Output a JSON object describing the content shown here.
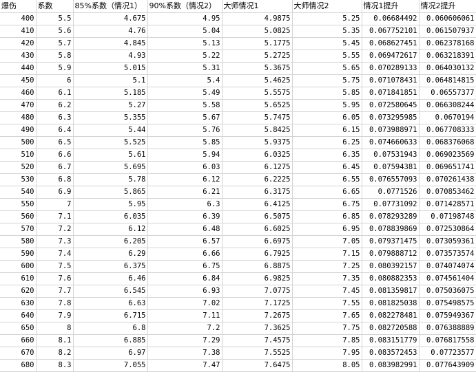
{
  "sheet": {
    "headers": [
      "爆伤",
      "系数",
      "85%系数（情况1）",
      "90%系数（情况2）",
      "大师情况1",
      "大师情况2",
      "情况1提升",
      "情况2提升"
    ],
    "rows": [
      [
        "400",
        "5.5",
        "4.675",
        "4.95",
        "4.9875",
        "5.25",
        "0.06684492",
        "0.060606061"
      ],
      [
        "410",
        "5.6",
        "4.76",
        "5.04",
        "5.0825",
        "5.35",
        "0.067752101",
        "0.061507937"
      ],
      [
        "420",
        "5.7",
        "4.845",
        "5.13",
        "5.1775",
        "5.45",
        "0.068627451",
        "0.062378168"
      ],
      [
        "430",
        "5.8",
        "4.93",
        "5.22",
        "5.2725",
        "5.55",
        "0.069472617",
        "0.063218391"
      ],
      [
        "440",
        "5.9",
        "5.015",
        "5.31",
        "5.3675",
        "5.65",
        "0.070289133",
        "0.064030132"
      ],
      [
        "450",
        "6",
        "5.1",
        "5.4",
        "5.4625",
        "5.75",
        "0.071078431",
        "0.064814815"
      ],
      [
        "460",
        "6.1",
        "5.185",
        "5.49",
        "5.5575",
        "5.85",
        "0.071841851",
        "0.06557377"
      ],
      [
        "470",
        "6.2",
        "5.27",
        "5.58",
        "5.6525",
        "5.95",
        "0.072580645",
        "0.066308244"
      ],
      [
        "480",
        "6.3",
        "5.355",
        "5.67",
        "5.7475",
        "6.05",
        "0.073295985",
        "0.0670194"
      ],
      [
        "490",
        "6.4",
        "5.44",
        "5.76",
        "5.8425",
        "6.15",
        "0.073988971",
        "0.067708333"
      ],
      [
        "500",
        "6.5",
        "5.525",
        "5.85",
        "5.9375",
        "6.25",
        "0.074660633",
        "0.068376068"
      ],
      [
        "510",
        "6.6",
        "5.61",
        "5.94",
        "6.0325",
        "6.35",
        "0.07531943",
        "0.069023569"
      ],
      [
        "520",
        "6.7",
        "5.695",
        "6.03",
        "6.1275",
        "6.45",
        "0.07594381",
        "0.069651741"
      ],
      [
        "530",
        "6.8",
        "5.78",
        "6.12",
        "6.2225",
        "6.55",
        "0.076557093",
        "0.070261438"
      ],
      [
        "540",
        "6.9",
        "5.865",
        "6.21",
        "6.3175",
        "6.65",
        "0.0771526",
        "0.070853462"
      ],
      [
        "550",
        "7",
        "5.95",
        "6.3",
        "6.4125",
        "6.75",
        "0.07731092",
        "0.071428571"
      ],
      [
        "560",
        "7.1",
        "6.035",
        "6.39",
        "6.5075",
        "6.85",
        "0.078293289",
        "0.07198748"
      ],
      [
        "570",
        "7.2",
        "6.12",
        "6.48",
        "6.6025",
        "6.95",
        "0.078839869",
        "0.072530864"
      ],
      [
        "580",
        "7.3",
        "6.205",
        "6.57",
        "6.6975",
        "7.05",
        "0.079371475",
        "0.073059361"
      ],
      [
        "590",
        "7.4",
        "6.29",
        "6.66",
        "6.7925",
        "7.15",
        "0.079888712",
        "0.073573574"
      ],
      [
        "600",
        "7.5",
        "6.375",
        "6.75",
        "6.8875",
        "7.25",
        "0.080392157",
        "0.074074074"
      ],
      [
        "610",
        "7.6",
        "6.46",
        "6.84",
        "6.9825",
        "7.35",
        "0.080882353",
        "0.074561404"
      ],
      [
        "620",
        "7.7",
        "6.545",
        "6.93",
        "7.0775",
        "7.45",
        "0.081359817",
        "0.075036075"
      ],
      [
        "630",
        "7.8",
        "6.63",
        "7.02",
        "7.1725",
        "7.55",
        "0.081825038",
        "0.075498575"
      ],
      [
        "640",
        "7.9",
        "6.715",
        "7.11",
        "7.2675",
        "7.65",
        "0.082278481",
        "0.075949367"
      ],
      [
        "650",
        "8",
        "6.8",
        "7.2",
        "7.3625",
        "7.75",
        "0.082720588",
        "0.076388889"
      ],
      [
        "660",
        "8.1",
        "6.885",
        "7.29",
        "7.4575",
        "7.85",
        "0.083151779",
        "0.076817558"
      ],
      [
        "670",
        "8.2",
        "6.97",
        "7.38",
        "7.5525",
        "7.95",
        "0.083572453",
        "0.07723577"
      ],
      [
        "680",
        "8.3",
        "7.055",
        "7.47",
        "7.6475",
        "8.05",
        "0.083982991",
        "0.077643909"
      ]
    ]
  }
}
